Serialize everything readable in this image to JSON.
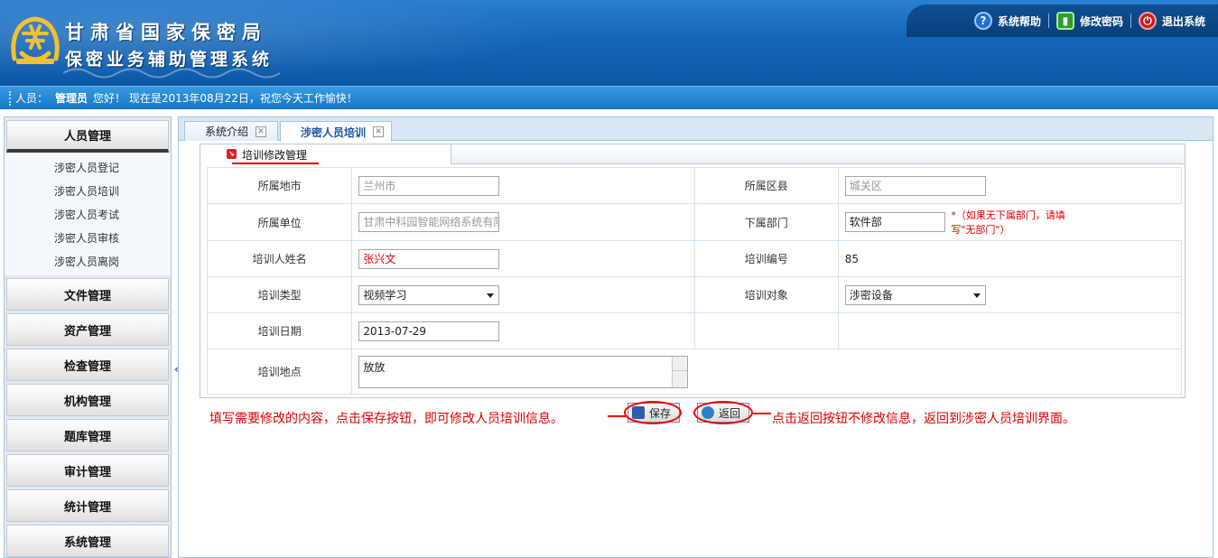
{
  "header": {
    "title_line1": "甘肃省国家保密局",
    "title_line2": "保密业务辅助管理系统",
    "links": [
      {
        "label": "系统帮助",
        "icon": "help-icon",
        "color": "#1f6fd0"
      },
      {
        "label": "修改密码",
        "icon": "lock-icon",
        "color": "#2aa02a"
      },
      {
        "label": "退出系统",
        "icon": "power-icon",
        "color": "#c41f1f"
      }
    ]
  },
  "statusbar": {
    "prefix": "人员：",
    "user": "管理员",
    "greeting": "您好！  现在是2013年08月22日，祝您今天工作愉快！"
  },
  "sidebar": {
    "menus": [
      {
        "label": "人员管理",
        "items": [
          "涉密人员登记",
          "涉密人员培训",
          "涉密人员考试",
          "涉密人员审核",
          "涉密人员离岗"
        ]
      },
      {
        "label": "文件管理"
      },
      {
        "label": "资产管理"
      },
      {
        "label": "检查管理"
      },
      {
        "label": "机构管理"
      },
      {
        "label": "题库管理"
      },
      {
        "label": "审计管理"
      },
      {
        "label": "统计管理"
      },
      {
        "label": "系统管理"
      }
    ],
    "collapse": "«"
  },
  "tabs": [
    "系统介绍",
    "涉密人员培训"
  ],
  "panel": {
    "title": "培训修改管理"
  },
  "form": {
    "city_label": "所属地市",
    "city_value": "兰州市",
    "county_label": "所属区县",
    "county_value": "城关区",
    "unit_label": "所属单位",
    "unit_value": "甘肃中科园智能网络系统有限公司",
    "dept_label": "下属部门",
    "dept_value": "软件部",
    "dept_note": "*（如果无下属部门，请填写\"无部门\"）",
    "name_label": "培训人姓名",
    "name_value": "张兴文",
    "code_label": "培训编号",
    "code_value": "85",
    "type_label": "培训类型",
    "type_value": "视频学习",
    "target_label": "培训对象",
    "target_value": "涉密设备",
    "date_label": "培训日期",
    "date_value": "2013-07-29",
    "place_label": "培训地点",
    "place_value": "放放"
  },
  "buttons": {
    "save": "保存",
    "back": "返回"
  },
  "hints": {
    "left": "填写需要修改的内容，点击保存按钮，即可修改人员培训信息。",
    "right": "点击返回按钮不修改信息，返回到涉密人员培训界面。"
  }
}
